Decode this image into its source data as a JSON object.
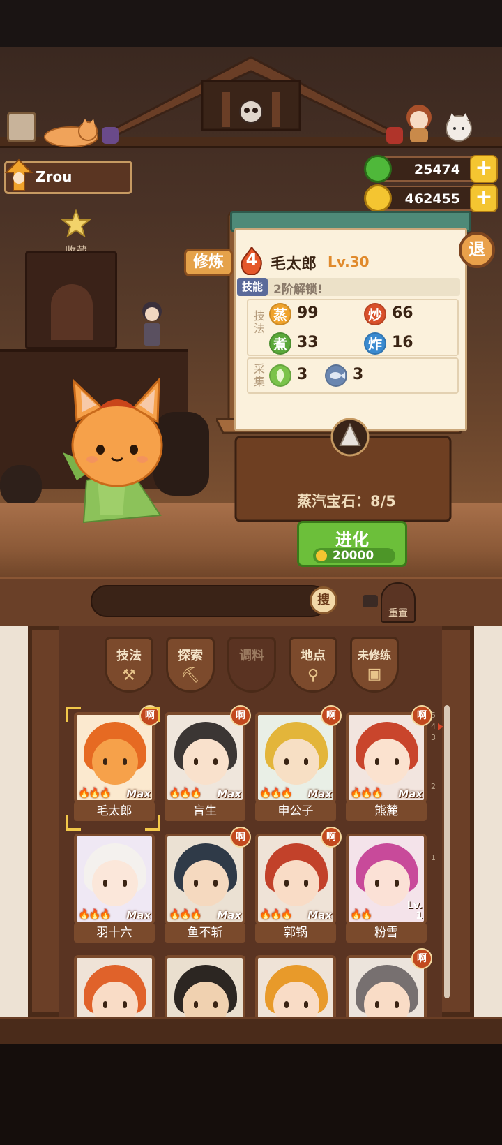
{
  "player": {
    "name": "Zrou"
  },
  "currency": {
    "jade": "25474",
    "coins": "462455",
    "plus": "+"
  },
  "favorite": {
    "label": "收藏"
  },
  "panel": {
    "tab": "修炼",
    "rank": "4",
    "name": "毛太郎",
    "level": "Lv.30",
    "exit": "退",
    "skill_tag": "技能",
    "skill_text": "2阶解锁!",
    "technique_label": "技法",
    "gather_label": "采集",
    "stats": [
      {
        "icon": "蒸",
        "value": "99",
        "color": "#f0a32c"
      },
      {
        "icon": "炒",
        "value": "66",
        "color": "#d9502a"
      },
      {
        "icon": "煮",
        "value": "33",
        "color": "#5aa83a"
      },
      {
        "icon": "炸",
        "value": "16",
        "color": "#3a8ad0"
      }
    ],
    "gather": [
      {
        "icon": "vegetable-icon",
        "value": "3",
        "color": "#7ac34a"
      },
      {
        "icon": "fish-icon",
        "value": "3",
        "color": "#6a86b0"
      }
    ]
  },
  "gem": {
    "text": "蒸汽宝石：8/5"
  },
  "evolve": {
    "label": "进化",
    "cost": "20000"
  },
  "search": {
    "button": "搜",
    "reset": "重置"
  },
  "filters": [
    {
      "label": "技法",
      "icon": "spatula-icon",
      "disabled": false
    },
    {
      "label": "探索",
      "icon": "shovel-icon",
      "disabled": false
    },
    {
      "label": "调料",
      "icon": "",
      "disabled": true
    },
    {
      "label": "地点",
      "icon": "location-icon",
      "disabled": false
    },
    {
      "label": "未修练",
      "icon": "book-icon",
      "disabled": false
    }
  ],
  "cards": [
    {
      "name": "毛太郎",
      "max": "Max",
      "badge": "啊",
      "skin": "#f6a14a",
      "hair": "#e66a22",
      "bg": "#fbe9cf"
    },
    {
      "name": "盲生",
      "max": "Max",
      "badge": "啊",
      "skin": "#f9e1cc",
      "hair": "#3b3634",
      "bg": "#efe6dc"
    },
    {
      "name": "申公子",
      "max": "Max",
      "badge": "啊",
      "skin": "#f7dfc4",
      "hair": "#e3b53a",
      "bg": "#e9efe6"
    },
    {
      "name": "熊麓",
      "max": "Max",
      "badge": "啊",
      "skin": "#fbe2cf",
      "hair": "#c9452c",
      "bg": "#f2e5df"
    },
    {
      "name": "羽十六",
      "max": "Max",
      "badge": "",
      "skin": "#fbe7da",
      "hair": "#f4f1ee",
      "bg": "#efe8f4"
    },
    {
      "name": "鱼不斩",
      "max": "Max",
      "badge": "啊",
      "skin": "#f5d9bf",
      "hair": "#2f3a48",
      "bg": "#ebe1d3"
    },
    {
      "name": "郭锅",
      "max": "Max",
      "badge": "啊",
      "skin": "#f9dcc6",
      "hair": "#c2412a",
      "bg": "#efe3d7"
    },
    {
      "name": "粉雪",
      "max": "",
      "badge": "",
      "lv": "Lv.\n1",
      "skin": "#fbe1d6",
      "hair": "#c84a9a",
      "bg": "#f4e3ea"
    },
    {
      "name": "",
      "max": "",
      "badge": "",
      "skin": "#f9dcc6",
      "hair": "#e0622a",
      "bg": "#efe3d7"
    },
    {
      "name": "",
      "max": "",
      "badge": "",
      "skin": "#f0d1b0",
      "hair": "#2c2622",
      "bg": "#eadfcf"
    },
    {
      "name": "",
      "max": "",
      "badge": "",
      "skin": "#f9dcc6",
      "hair": "#e89a2a",
      "bg": "#efe3d7"
    },
    {
      "name": "",
      "max": "",
      "badge": "啊",
      "skin": "#f9dcc6",
      "hair": "#777070",
      "bg": "#ece4dc"
    }
  ],
  "scroll_ticks": [
    "5",
    "4",
    "3",
    "2",
    "1"
  ]
}
